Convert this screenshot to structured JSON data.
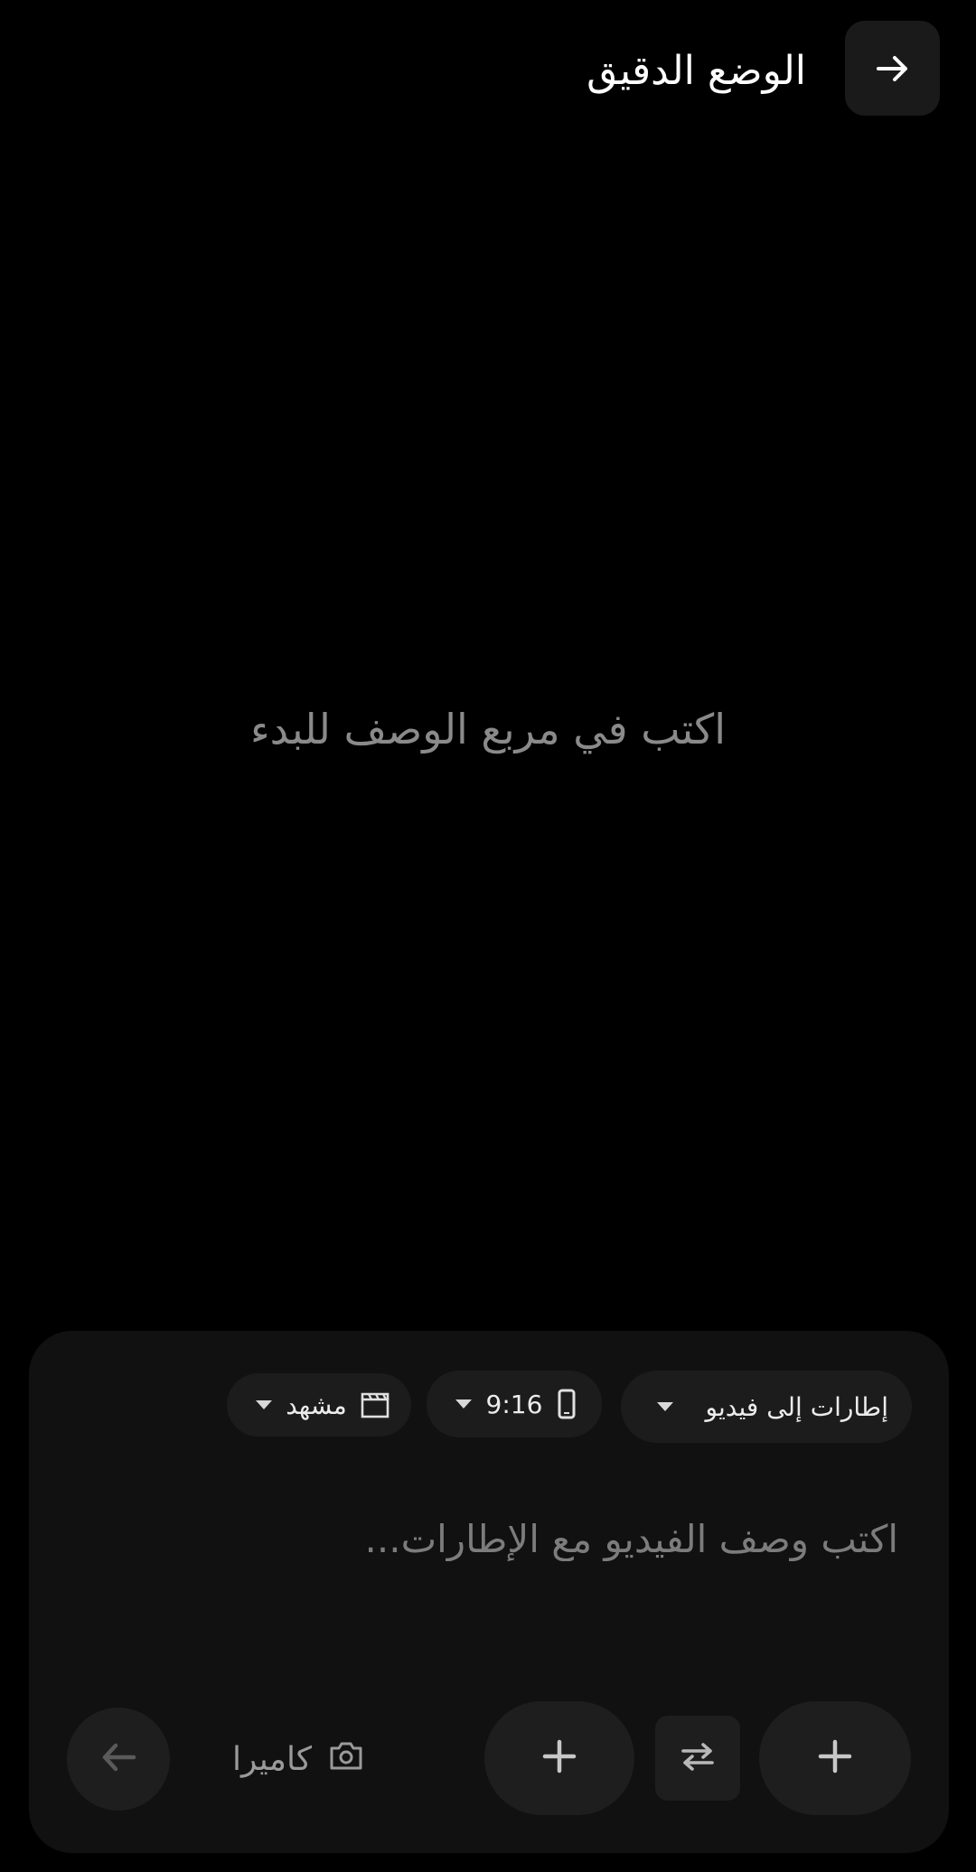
{
  "header": {
    "title": "الوضع الدقيق",
    "back_icon": "arrow-right-icon"
  },
  "main": {
    "empty_hint": "اكتب في مربع الوصف للبدء"
  },
  "composer": {
    "mode_chip": {
      "label": "إطارات إلى فيديو",
      "icon": "chevron-down-icon"
    },
    "ratio_chip": {
      "label": "9:16",
      "icon": "phone-portrait-icon"
    },
    "scene_chip": {
      "label": "مشهد",
      "icon": "clapperboard-icon"
    },
    "prompt": {
      "placeholder": "اكتب وصف الفيديو مع الإطارات...",
      "value": ""
    },
    "camera": {
      "label": "كاميرا",
      "icon": "camera-icon"
    },
    "buttons": {
      "nav_back_icon": "arrow-left-icon",
      "add_start_frame_icon": "plus-icon",
      "swap_icon": "swap-arrows-icon",
      "add_end_frame_icon": "plus-icon"
    }
  },
  "colors": {
    "background": "#000000",
    "panel": "#111111",
    "chip": "#1c1c1c",
    "button": "#1e1e1e",
    "text_primary": "#ffffff",
    "text_muted": "#8a8a8a"
  }
}
